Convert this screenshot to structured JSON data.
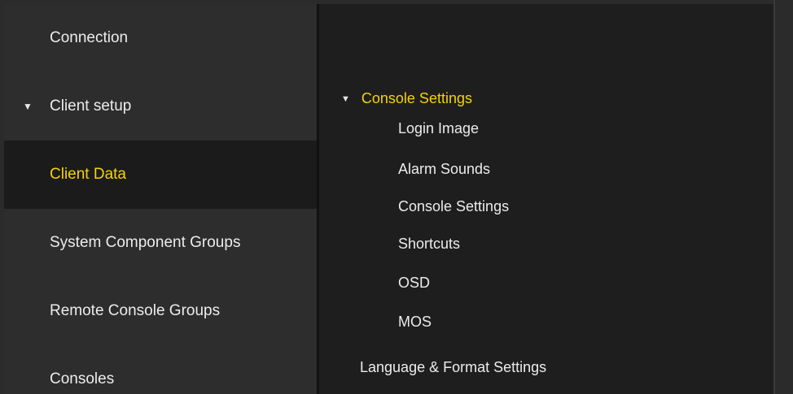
{
  "sidebar": {
    "items": [
      {
        "label": "Connection",
        "caret": ""
      },
      {
        "label": "Client setup",
        "caret": "▼"
      },
      {
        "label": "Client Data",
        "caret": ""
      },
      {
        "label": "System Component Groups",
        "caret": ""
      },
      {
        "label": "Remote Console Groups",
        "caret": ""
      },
      {
        "label": "Consoles",
        "caret": ""
      }
    ],
    "active_index": 2
  },
  "content": {
    "group": {
      "label": "Console Settings",
      "caret": "▼"
    },
    "children": [
      "Login Image",
      "Alarm Sounds",
      "Console Settings",
      "Shortcuts",
      "OSD",
      "MOS"
    ],
    "footer_item": "Language & Format Settings"
  },
  "colors": {
    "accent": "#f4d20a",
    "sidebar_bg": "#2d2d2d",
    "active_bg": "#1b1b1b",
    "content_bg": "#1e1e1e",
    "text": "#ececec"
  }
}
